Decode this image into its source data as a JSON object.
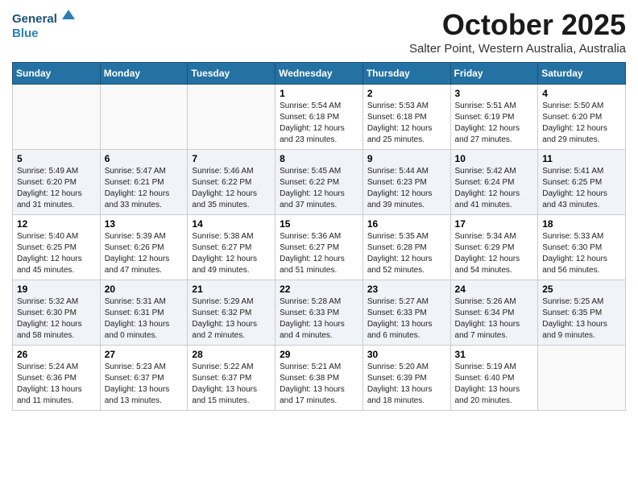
{
  "header": {
    "logo_general": "General",
    "logo_blue": "Blue",
    "month": "October 2025",
    "location": "Salter Point, Western Australia, Australia"
  },
  "weekdays": [
    "Sunday",
    "Monday",
    "Tuesday",
    "Wednesday",
    "Thursday",
    "Friday",
    "Saturday"
  ],
  "weeks": [
    [
      {
        "day": "",
        "detail": ""
      },
      {
        "day": "",
        "detail": ""
      },
      {
        "day": "",
        "detail": ""
      },
      {
        "day": "1",
        "detail": "Sunrise: 5:54 AM\nSunset: 6:18 PM\nDaylight: 12 hours\nand 23 minutes."
      },
      {
        "day": "2",
        "detail": "Sunrise: 5:53 AM\nSunset: 6:18 PM\nDaylight: 12 hours\nand 25 minutes."
      },
      {
        "day": "3",
        "detail": "Sunrise: 5:51 AM\nSunset: 6:19 PM\nDaylight: 12 hours\nand 27 minutes."
      },
      {
        "day": "4",
        "detail": "Sunrise: 5:50 AM\nSunset: 6:20 PM\nDaylight: 12 hours\nand 29 minutes."
      }
    ],
    [
      {
        "day": "5",
        "detail": "Sunrise: 5:49 AM\nSunset: 6:20 PM\nDaylight: 12 hours\nand 31 minutes."
      },
      {
        "day": "6",
        "detail": "Sunrise: 5:47 AM\nSunset: 6:21 PM\nDaylight: 12 hours\nand 33 minutes."
      },
      {
        "day": "7",
        "detail": "Sunrise: 5:46 AM\nSunset: 6:22 PM\nDaylight: 12 hours\nand 35 minutes."
      },
      {
        "day": "8",
        "detail": "Sunrise: 5:45 AM\nSunset: 6:22 PM\nDaylight: 12 hours\nand 37 minutes."
      },
      {
        "day": "9",
        "detail": "Sunrise: 5:44 AM\nSunset: 6:23 PM\nDaylight: 12 hours\nand 39 minutes."
      },
      {
        "day": "10",
        "detail": "Sunrise: 5:42 AM\nSunset: 6:24 PM\nDaylight: 12 hours\nand 41 minutes."
      },
      {
        "day": "11",
        "detail": "Sunrise: 5:41 AM\nSunset: 6:25 PM\nDaylight: 12 hours\nand 43 minutes."
      }
    ],
    [
      {
        "day": "12",
        "detail": "Sunrise: 5:40 AM\nSunset: 6:25 PM\nDaylight: 12 hours\nand 45 minutes."
      },
      {
        "day": "13",
        "detail": "Sunrise: 5:39 AM\nSunset: 6:26 PM\nDaylight: 12 hours\nand 47 minutes."
      },
      {
        "day": "14",
        "detail": "Sunrise: 5:38 AM\nSunset: 6:27 PM\nDaylight: 12 hours\nand 49 minutes."
      },
      {
        "day": "15",
        "detail": "Sunrise: 5:36 AM\nSunset: 6:27 PM\nDaylight: 12 hours\nand 51 minutes."
      },
      {
        "day": "16",
        "detail": "Sunrise: 5:35 AM\nSunset: 6:28 PM\nDaylight: 12 hours\nand 52 minutes."
      },
      {
        "day": "17",
        "detail": "Sunrise: 5:34 AM\nSunset: 6:29 PM\nDaylight: 12 hours\nand 54 minutes."
      },
      {
        "day": "18",
        "detail": "Sunrise: 5:33 AM\nSunset: 6:30 PM\nDaylight: 12 hours\nand 56 minutes."
      }
    ],
    [
      {
        "day": "19",
        "detail": "Sunrise: 5:32 AM\nSunset: 6:30 PM\nDaylight: 12 hours\nand 58 minutes."
      },
      {
        "day": "20",
        "detail": "Sunrise: 5:31 AM\nSunset: 6:31 PM\nDaylight: 13 hours\nand 0 minutes."
      },
      {
        "day": "21",
        "detail": "Sunrise: 5:29 AM\nSunset: 6:32 PM\nDaylight: 13 hours\nand 2 minutes."
      },
      {
        "day": "22",
        "detail": "Sunrise: 5:28 AM\nSunset: 6:33 PM\nDaylight: 13 hours\nand 4 minutes."
      },
      {
        "day": "23",
        "detail": "Sunrise: 5:27 AM\nSunset: 6:33 PM\nDaylight: 13 hours\nand 6 minutes."
      },
      {
        "day": "24",
        "detail": "Sunrise: 5:26 AM\nSunset: 6:34 PM\nDaylight: 13 hours\nand 7 minutes."
      },
      {
        "day": "25",
        "detail": "Sunrise: 5:25 AM\nSunset: 6:35 PM\nDaylight: 13 hours\nand 9 minutes."
      }
    ],
    [
      {
        "day": "26",
        "detail": "Sunrise: 5:24 AM\nSunset: 6:36 PM\nDaylight: 13 hours\nand 11 minutes."
      },
      {
        "day": "27",
        "detail": "Sunrise: 5:23 AM\nSunset: 6:37 PM\nDaylight: 13 hours\nand 13 minutes."
      },
      {
        "day": "28",
        "detail": "Sunrise: 5:22 AM\nSunset: 6:37 PM\nDaylight: 13 hours\nand 15 minutes."
      },
      {
        "day": "29",
        "detail": "Sunrise: 5:21 AM\nSunset: 6:38 PM\nDaylight: 13 hours\nand 17 minutes."
      },
      {
        "day": "30",
        "detail": "Sunrise: 5:20 AM\nSunset: 6:39 PM\nDaylight: 13 hours\nand 18 minutes."
      },
      {
        "day": "31",
        "detail": "Sunrise: 5:19 AM\nSunset: 6:40 PM\nDaylight: 13 hours\nand 20 minutes."
      },
      {
        "day": "",
        "detail": ""
      }
    ]
  ]
}
